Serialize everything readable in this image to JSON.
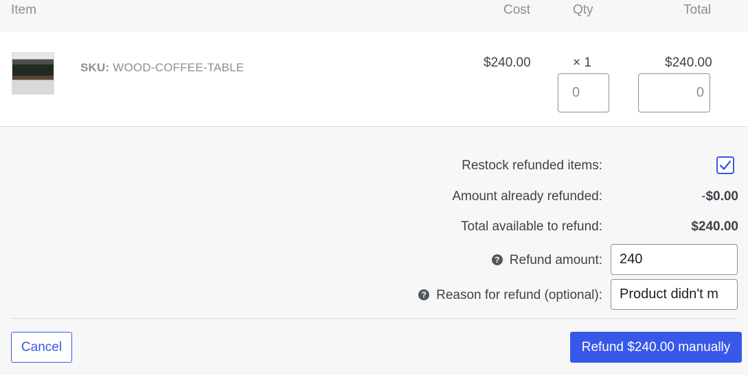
{
  "table": {
    "headers": {
      "item": "Item",
      "cost": "Cost",
      "qty": "Qty",
      "total": "Total"
    },
    "rows": [
      {
        "sku_label": "SKU:",
        "sku": "WOOD-COFFEE-TABLE",
        "cost": "$240.00",
        "qty": "× 1",
        "total": "$240.00",
        "refund_qty": "0",
        "refund_total": "0"
      }
    ]
  },
  "summary": {
    "restock_label": "Restock refunded items:",
    "restock_checked": true,
    "already_refunded_label": "Amount already refunded:",
    "already_refunded_prefix": "-",
    "already_refunded_value": "$0.00",
    "available_label": "Total available to refund:",
    "available_value": "$240.00",
    "refund_amount_label": "Refund amount:",
    "refund_amount_value": "240",
    "reason_label": "Reason for refund (optional):",
    "reason_value": "Product didn't m"
  },
  "actions": {
    "cancel_label": "Cancel",
    "refund_label": "Refund $240.00 manually"
  },
  "icons": {
    "help": "help-icon",
    "check": "checkmark-icon"
  },
  "colors": {
    "accent": "#3858e9",
    "text": "#3c434a",
    "muted": "#8c8f94"
  }
}
